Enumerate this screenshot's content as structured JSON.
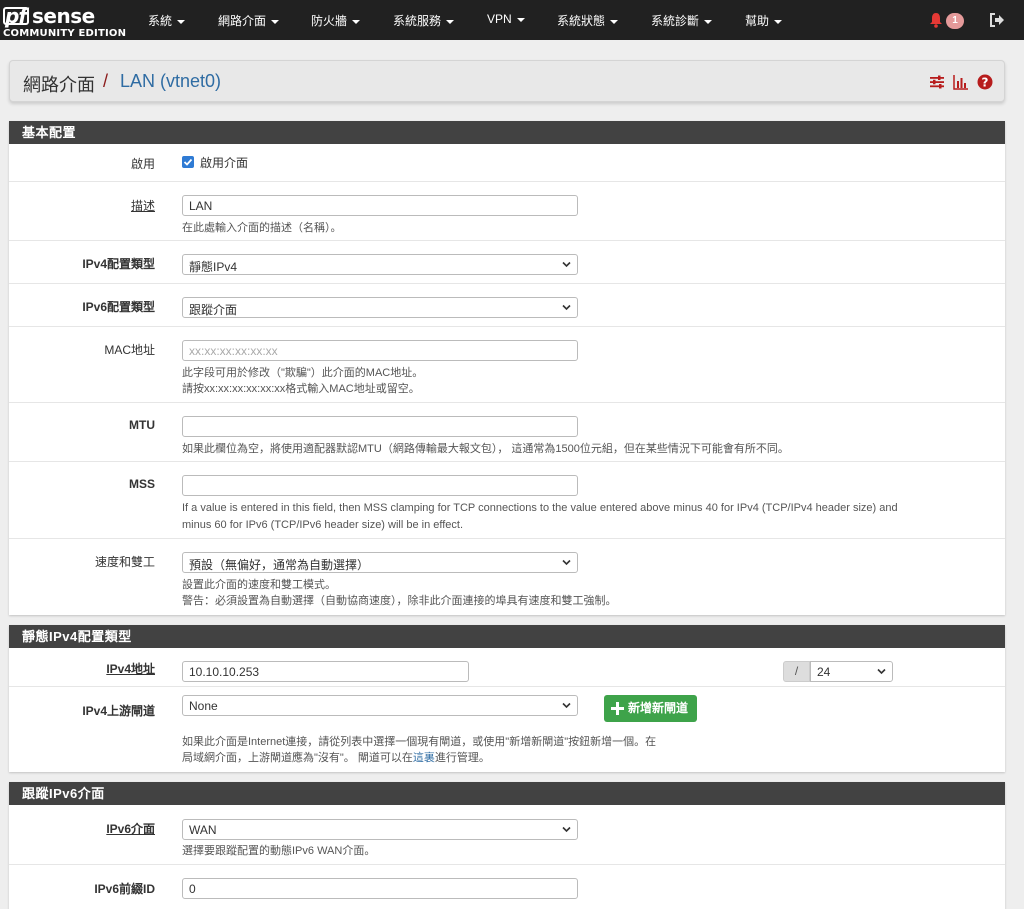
{
  "brand": {
    "logo_main": "sense",
    "logo_prefix": "pf",
    "edition": "COMMUNITY EDITION"
  },
  "nav": {
    "items": [
      {
        "label": "系統"
      },
      {
        "label": "網路介面"
      },
      {
        "label": "防火牆"
      },
      {
        "label": "系統服務"
      },
      {
        "label": "VPN"
      },
      {
        "label": "系統狀態"
      },
      {
        "label": "系統診斷"
      },
      {
        "label": "幫助"
      }
    ],
    "notification_count": "1"
  },
  "breadcrumb": {
    "section": "網路介面",
    "separator": "/",
    "page": "LAN (vtnet0)"
  },
  "colors": {
    "navbar": "#212121",
    "panel_header": "#424242",
    "link": "#2f6ca3",
    "accent_red": "#b71c1c",
    "button_green": "#3ea34a",
    "badge": "#e59a9a"
  },
  "basic": {
    "title": "基本配置",
    "enable": {
      "label": "啟用",
      "checkbox_label": "啟用介面",
      "checked": true
    },
    "description": {
      "label": "描述",
      "value": "LAN",
      "help": "在此處輸入介面的描述（名稱）。"
    },
    "ipv4_type": {
      "label": "IPv4配置類型",
      "value": "靜態IPv4"
    },
    "ipv6_type": {
      "label": "IPv6配置類型",
      "value": "跟蹤介面"
    },
    "mac": {
      "label": "MAC地址",
      "placeholder": "xx:xx:xx:xx:xx:xx",
      "help1": "此字段可用於修改（\"欺騙\"）此介面的MAC地址。",
      "help2": "請按xx:xx:xx:xx:xx:xx格式輸入MAC地址或留空。"
    },
    "mtu": {
      "label": "MTU",
      "value": "",
      "help": "如果此欄位為空，將使用適配器默認MTU（網路傳輸最大報文包）， 這通常為1500位元組，但在某些情況下可能會有所不同。"
    },
    "mss": {
      "label": "MSS",
      "value": "",
      "help1": "If a value is entered in this field, then MSS clamping for TCP connections to the value entered above minus 40 for IPv4 (TCP/IPv4 header size) and",
      "help2": "minus 60 for IPv6 (TCP/IPv6 header size) will be in effect."
    },
    "speed": {
      "label": "速度和雙工",
      "value": "預設（無偏好，通常為自動選擇）",
      "help1": "設置此介面的速度和雙工模式。",
      "help2": "警告：必須設置為自動選擇（自動協商速度），除非此介面連接的埠具有速度和雙工強制。"
    }
  },
  "static_ipv4": {
    "title": "靜態IPv4配置類型",
    "address": {
      "label": "IPv4地址",
      "value": "10.10.10.253",
      "slash": "/",
      "cidr": "24"
    },
    "gateway": {
      "label": "IPv4上游閘道",
      "value": "None",
      "add_button": "新增新閘道",
      "help1": "如果此介面是Internet連接，請從列表中選擇一個現有閘道，或使用\"新增新閘道\"按鈕新增一個。在",
      "help2_a": "局域網介面，上游閘道應為\"沒有\"。 閘道可以在",
      "help2_link": "這裏",
      "help2_b": "進行管理。"
    }
  },
  "track_ipv6": {
    "title": "跟蹤IPv6介面",
    "interface": {
      "label": "IPv6介面",
      "value": "WAN",
      "help": "選擇要跟蹤配置的動態IPv6 WAN介面。"
    },
    "prefix_id": {
      "label": "IPv6前綴ID",
      "value": "0"
    }
  }
}
